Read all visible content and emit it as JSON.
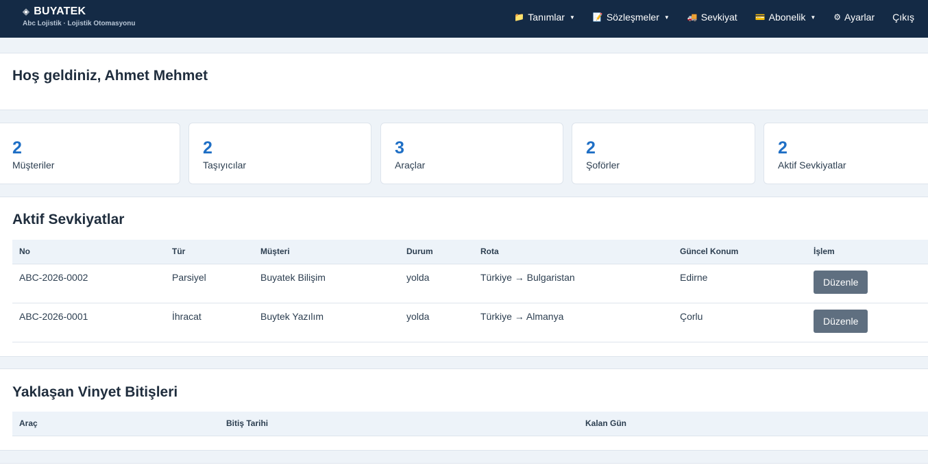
{
  "brand": {
    "icon": "diamond-icon",
    "title": "BUYATEK",
    "subtitle": "Abc Lojistik · Lojistik Otomasyonu"
  },
  "nav": {
    "items": [
      {
        "label": "Tanımlar",
        "icon": "folder-icon",
        "dropdown": true
      },
      {
        "label": "Sözleşmeler",
        "icon": "memo-icon",
        "dropdown": true
      },
      {
        "label": "Sevkiyat",
        "icon": "truck-icon",
        "dropdown": false
      },
      {
        "label": "Abonelik",
        "icon": "card-icon",
        "dropdown": true
      },
      {
        "label": "Ayarlar",
        "icon": "gear-icon",
        "dropdown": false
      },
      {
        "label": "Çıkış",
        "icon": "",
        "dropdown": false
      }
    ]
  },
  "welcome": {
    "title": "Hoş geldiniz, Ahmet Mehmet"
  },
  "stats": [
    {
      "value": "2",
      "label": "Müşteriler"
    },
    {
      "value": "2",
      "label": "Taşıyıcılar"
    },
    {
      "value": "3",
      "label": "Araçlar"
    },
    {
      "value": "2",
      "label": "Şoförler"
    },
    {
      "value": "2",
      "label": "Aktif Sevkiyatlar"
    }
  ],
  "shipments": {
    "title": "Aktif Sevkiyatlar",
    "columns": [
      "No",
      "Tür",
      "Müşteri",
      "Durum",
      "Rota",
      "Güncel Konum",
      "İşlem"
    ],
    "rows": [
      {
        "no": "ABC-2026-0002",
        "type": "Parsiyel",
        "customer": "Buyatek Bilişim",
        "status": "yolda",
        "route": "Türkiye → Bulgaristan",
        "location": "Edirne",
        "action": "Düzenle"
      },
      {
        "no": "ABC-2026-0001",
        "type": "İhracat",
        "customer": "Buytek Yazılım",
        "status": "yolda",
        "route": "Türkiye → Almanya",
        "location": "Çorlu",
        "action": "Düzenle"
      }
    ]
  },
  "vignettes": {
    "title": "Yaklaşan Vinyet Bitişleri",
    "columns": [
      "Araç",
      "Bitiş Tarihi",
      "Kalan Gün"
    ]
  },
  "colors": {
    "navbar": "#142a45",
    "accent": "#1f6fc5",
    "button": "#5f6f80",
    "table_header": "#edf3f9"
  }
}
